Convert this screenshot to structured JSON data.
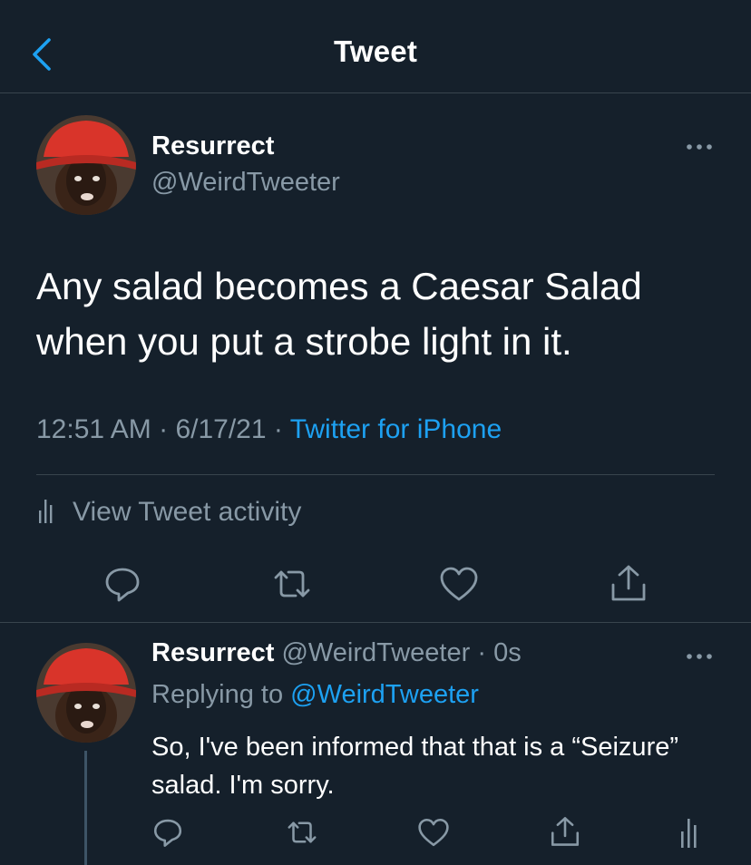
{
  "header": {
    "title": "Tweet",
    "back_icon": "chevron-left-icon"
  },
  "colors": {
    "background": "#15202b",
    "accent": "#1da1f2",
    "secondary_text": "#8899a6",
    "divider": "#38444d"
  },
  "tweet": {
    "author_name": "Resurrect",
    "author_handle": "@WeirdTweeter",
    "text": "Any salad becomes a Caesar Salad when you put a strobe light in it.",
    "time": "12:51 AM",
    "date": "6/17/21",
    "separator": "·",
    "source": "Twitter for iPhone",
    "activity_label": "View Tweet activity",
    "actions": [
      "reply-icon",
      "retweet-icon",
      "like-icon",
      "share-icon"
    ]
  },
  "reply": {
    "author_name": "Resurrect",
    "author_handle": "@WeirdTweeter",
    "time_ago": "0s",
    "separator": "·",
    "replying_to_label": "Replying to",
    "replying_to_handle": "@WeirdTweeter",
    "text": "So, I've been informed that that is a “Seizure” salad. I'm sorry.",
    "actions": [
      "reply-icon",
      "retweet-icon",
      "like-icon",
      "share-icon",
      "analytics-icon"
    ]
  }
}
